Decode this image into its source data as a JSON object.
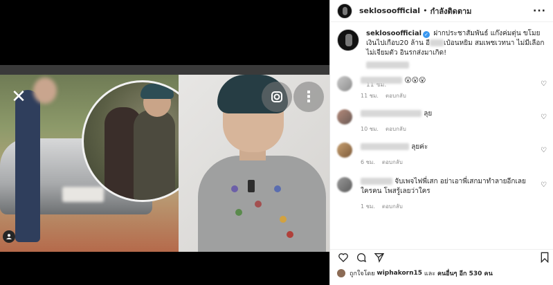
{
  "header": {
    "username": "seklosoofficial",
    "separator": "•",
    "follow_status": "กำลังติดตาม",
    "more": "···"
  },
  "caption": {
    "username": "seklosoofficial",
    "text_part1": "ฝากประชาสัมพันธ์ แก๊งค่มตุ่น ขโมยเงินไปเกือบ20 ล้าน อี",
    "text_part2": "เป๋อนหยิม สมเพชเวทนา ไม่มีเลือกไม่เจียมตัว อินรกส่งมาเกิด!",
    "time": "11 ชม."
  },
  "comments": [
    {
      "text": "😮😮😮",
      "time": "11 ชม.",
      "reply": "ตอบกลับ"
    },
    {
      "text": "ลุย",
      "time": "10 ชม.",
      "reply": "ตอบกลับ"
    },
    {
      "text": "ลุยค่ะ",
      "time": "6 ชม.",
      "reply": "ตอบกลับ"
    },
    {
      "text": "จับเพจไฟพี่เสก อย่าเอาพี่เสกมาทำลายอีกเลย ใครคน โพสรู้เลยว่าใคร",
      "time": "1 ชม.",
      "reply": "ตอบกลับ"
    }
  ],
  "likes": {
    "prefix": "ถูกใจโดย",
    "user": "wiphakorn15",
    "and": "และ",
    "others": "คนอื่นๆ อีก 530 คน"
  },
  "icons": {
    "close": "close-icon",
    "lens": "lens-icon",
    "more": "more-icon",
    "user_tag": "user-tag-icon",
    "heart": "heart-icon",
    "comment": "comment-icon",
    "share": "share-icon",
    "save": "bookmark-icon"
  }
}
